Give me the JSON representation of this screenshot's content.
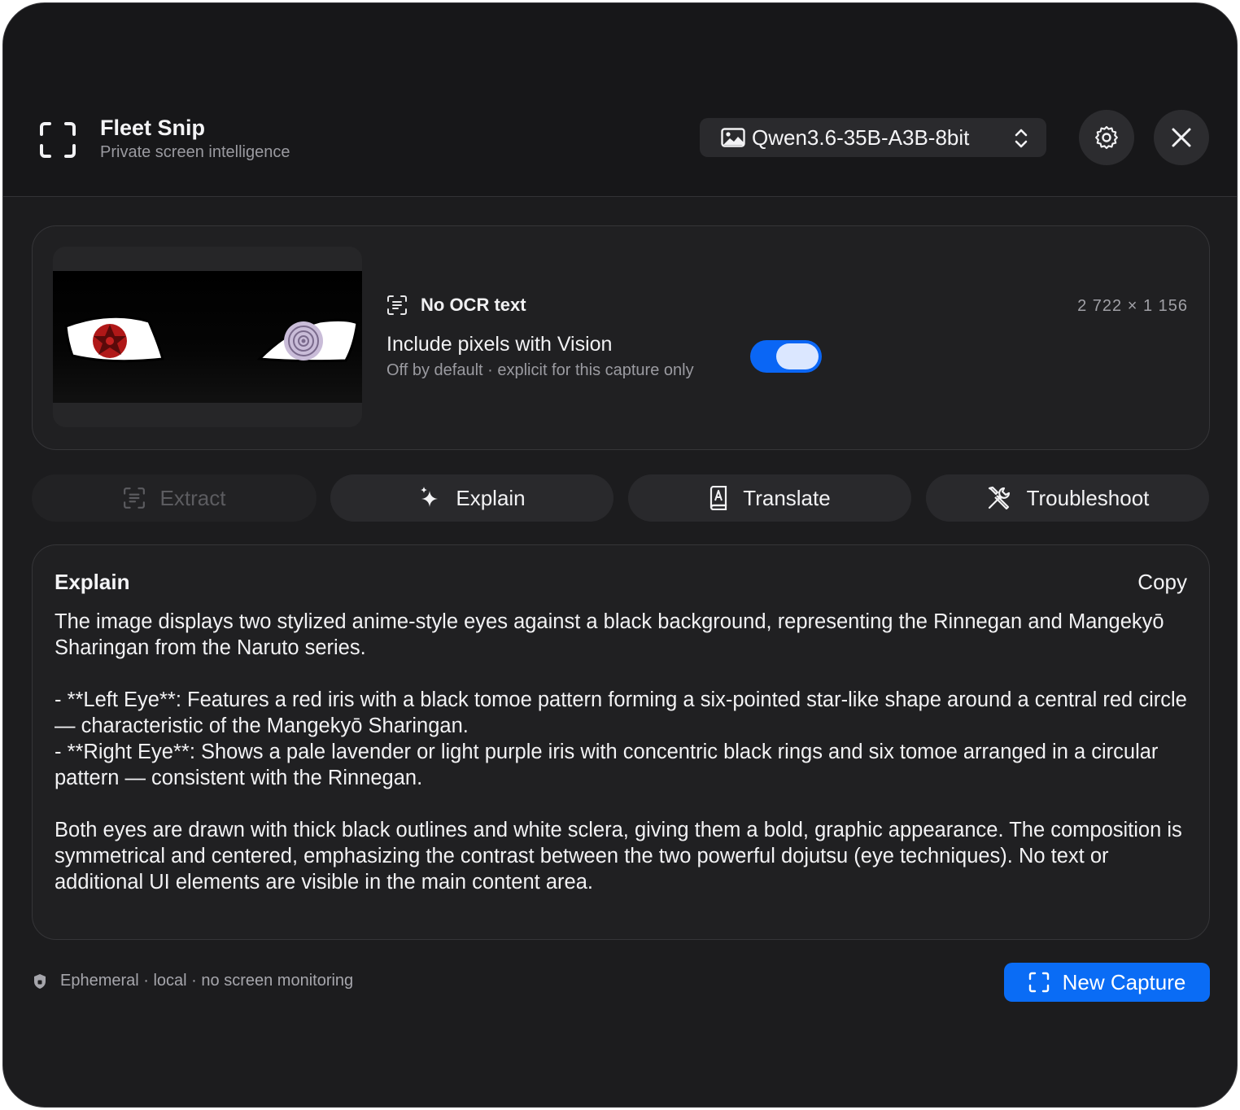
{
  "app": {
    "title": "Fleet Snip",
    "subtitle": "Private screen intelligence"
  },
  "header": {
    "model_label": "Qwen3.6-35B-A3B-8bit",
    "settings_icon": "gear-icon",
    "close_icon": "close-icon"
  },
  "capture": {
    "ocr_label": "No OCR text",
    "dimensions": "2 722 × 1 156",
    "vision_title": "Include pixels with Vision",
    "vision_subtitle": "Off by default · explicit for this capture only",
    "vision_enabled": true
  },
  "actions": [
    {
      "label": "Extract",
      "icon": "text-scan-icon",
      "enabled": false
    },
    {
      "label": "Explain",
      "icon": "sparkles-icon",
      "enabled": true
    },
    {
      "label": "Translate",
      "icon": "translate-book-icon",
      "enabled": true
    },
    {
      "label": "Troubleshoot",
      "icon": "tools-icon",
      "enabled": true
    }
  ],
  "result": {
    "title": "Explain",
    "copy_label": "Copy",
    "paragraphs": [
      "The image displays two stylized anime-style eyes against a black background, representing the Rinnegan and Mangekyō Sharingan from the Naruto series.",
      "- **Left Eye**: Features a red iris with a black tomoe pattern forming a six-pointed star-like shape around a central red circle — characteristic of the Mangekyō Sharingan.\n- **Right Eye**: Shows a pale lavender or light purple iris with concentric black rings and six tomoe arranged in a circular pattern — consistent with the Rinnegan.",
      "Both eyes are drawn with thick black outlines and white sclera, giving them a bold, graphic appearance. The composition is symmetrical and centered, emphasizing the contrast between the two powerful dojutsu (eye techniques). No text or additional UI elements are visible in the main content area."
    ]
  },
  "footer": {
    "note": "Ephemeral · local · no screen monitoring",
    "new_capture_label": "New Capture"
  },
  "colors": {
    "accent": "#0a6cf5",
    "background": "#1c1c1e",
    "card": "#202022"
  }
}
